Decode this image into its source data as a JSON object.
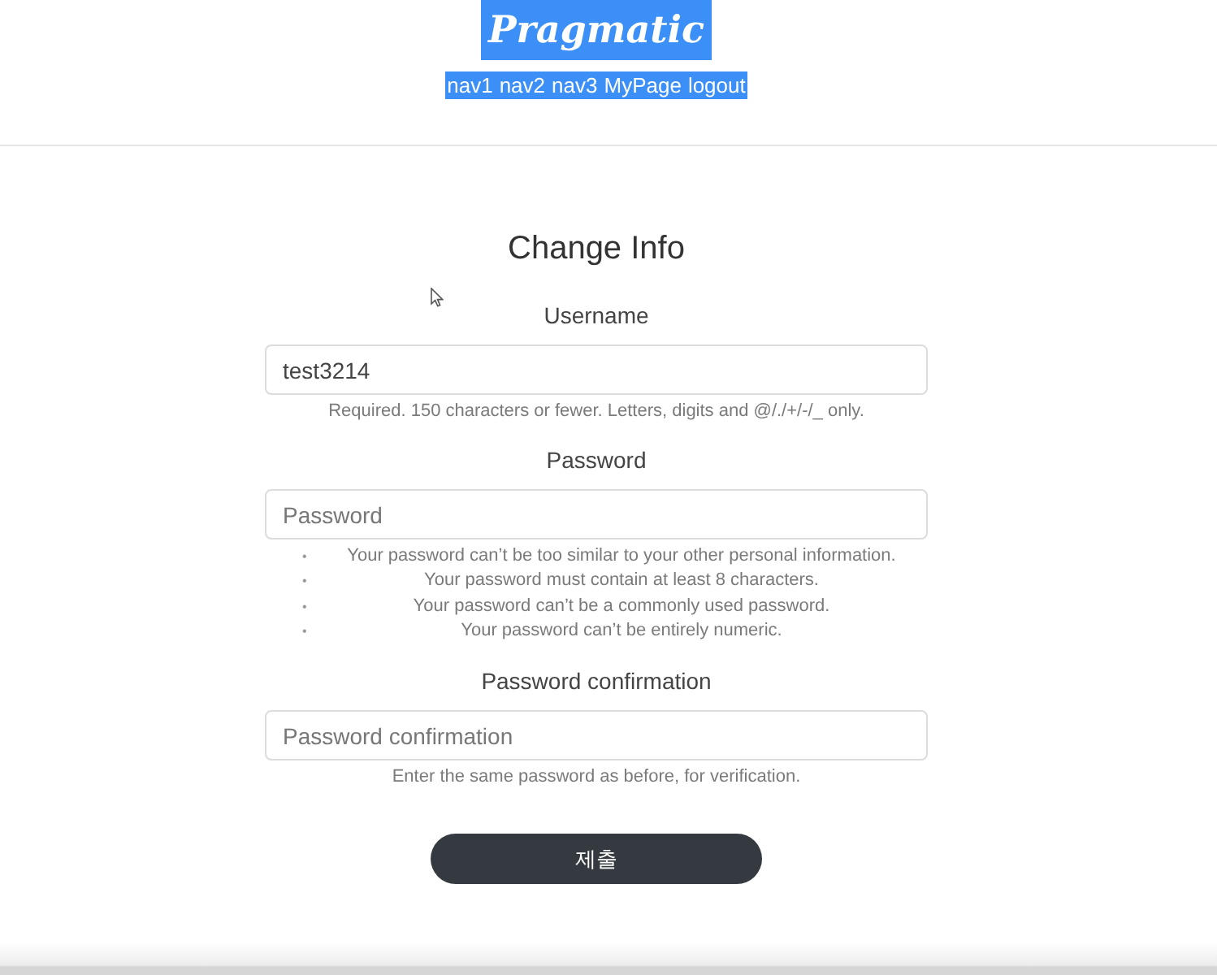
{
  "header": {
    "logo": "Pragmatic",
    "selected": true,
    "nav": [
      "nav1",
      "nav2",
      "nav3",
      "MyPage",
      "logout"
    ]
  },
  "form": {
    "title": "Change Info",
    "fields": [
      {
        "kind": "text",
        "label": "Username",
        "value": "test3214",
        "help": "Required. 150 characters or fewer. Letters, digits and @/./+/-/_ only."
      },
      {
        "kind": "list",
        "label": "Password",
        "placeholder": "Password",
        "help_items": [
          {
            "bullet": "•",
            "text": "Your password can’t be too similar to your other personal information."
          },
          {
            "bullet": "•",
            "text": "Your password must contain at least 8 characters."
          },
          {
            "bullet": "•",
            "text": "Your password can’t be a commonly used password."
          },
          {
            "bullet": "•",
            "text": "Your password can’t be entirely numeric."
          }
        ]
      },
      {
        "kind": "text",
        "label": "Password confirmation",
        "placeholder": "Password confirmation",
        "help": "Enter the same password as before, for verification."
      }
    ],
    "submit": "제출"
  }
}
